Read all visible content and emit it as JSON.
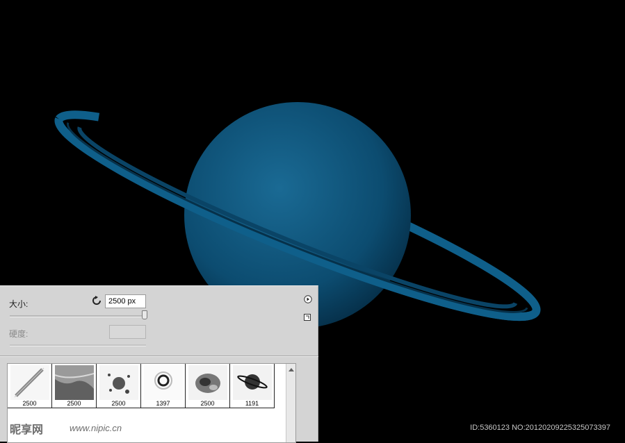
{
  "panel": {
    "size_label": "大小:",
    "size_value": "2500 px",
    "hardness_label": "硬度:"
  },
  "brushes": [
    {
      "size": "2500",
      "icon": "streak-brush-icon"
    },
    {
      "size": "2500",
      "icon": "texture-brush-icon"
    },
    {
      "size": "2500",
      "icon": "splatter-brush-icon"
    },
    {
      "size": "1397",
      "icon": "ring-brush-icon"
    },
    {
      "size": "2500",
      "icon": "nebula-brush-icon"
    },
    {
      "size": "1191",
      "icon": "planet-brush-icon"
    }
  ],
  "watermark": {
    "logo": "昵享网",
    "site": "www.nipic.cn"
  },
  "image_id": "ID:5360123 NO:20120209225325073397",
  "colors": {
    "planet": "#0d4f73",
    "ring": "#0f5f8a",
    "panel": "#d4d4d4",
    "space": "#000000"
  }
}
